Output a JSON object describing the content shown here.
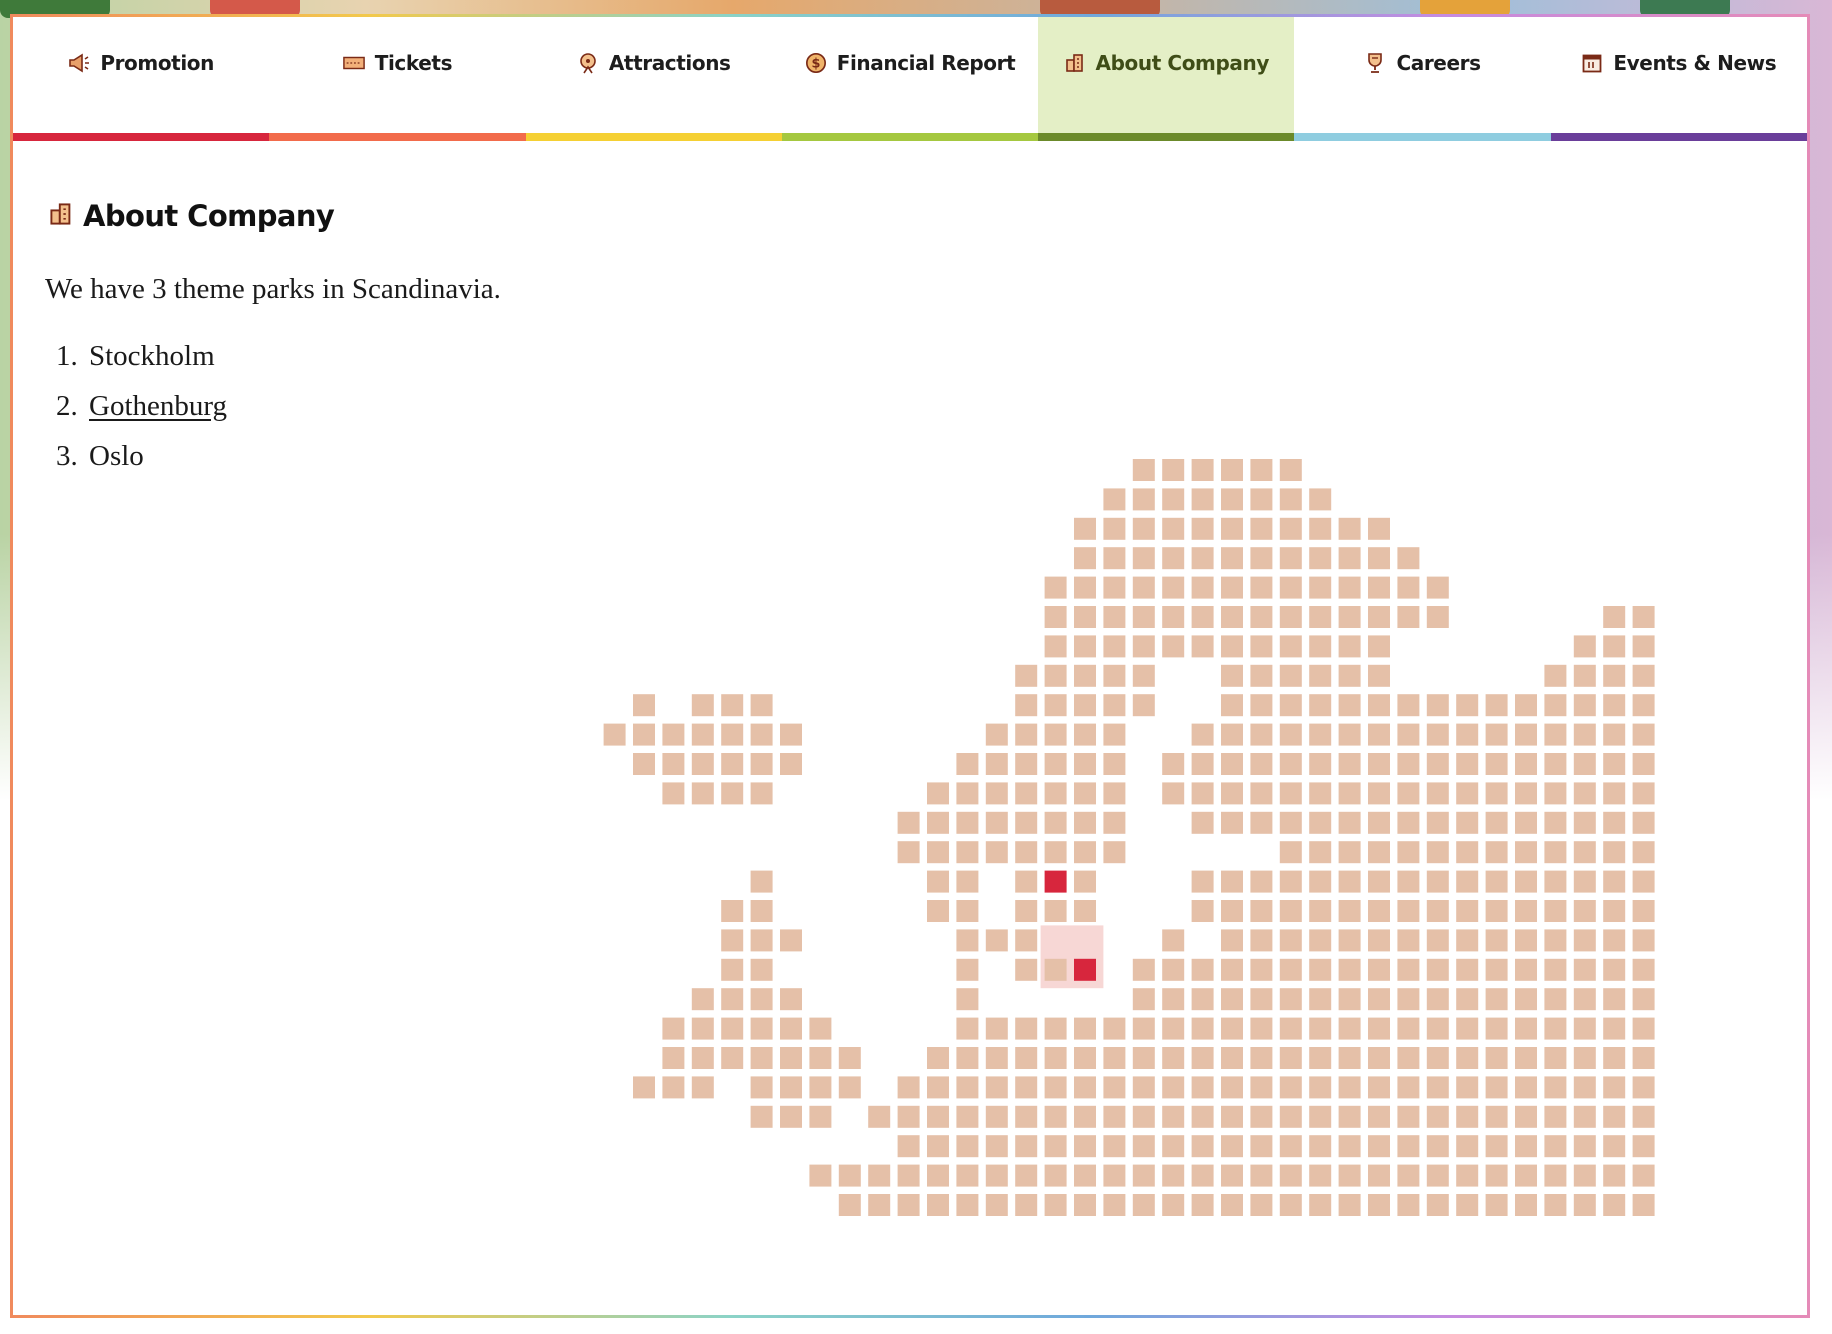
{
  "nav": {
    "tabs": [
      {
        "label": "Promotion",
        "icon": "megaphone-icon",
        "color": "#d7263d"
      },
      {
        "label": "Tickets",
        "icon": "ticket-icon",
        "color": "#f26b4b"
      },
      {
        "label": "Attractions",
        "icon": "ferris-wheel-icon",
        "color": "#f5d033"
      },
      {
        "label": "Financial Report",
        "icon": "dollar-coin-icon",
        "color": "#a5c840"
      },
      {
        "label": "About Company",
        "icon": "building-icon",
        "color": "#6b8a2a",
        "active": true
      },
      {
        "label": "Careers",
        "icon": "trophy-icon",
        "color": "#8fcde0"
      },
      {
        "label": "Events & News",
        "icon": "calendar-icon",
        "color": "#6a3e9a"
      }
    ]
  },
  "page": {
    "title": "About Company",
    "intro": "We have 3 theme parks in Scandinavia.",
    "parks": [
      "Stockholm",
      "Gothenburg",
      "Oslo"
    ]
  },
  "map": {
    "land_color": "#e5c0a8",
    "park_color": "#d7263d",
    "highlight_color": "#f7d7d5"
  }
}
